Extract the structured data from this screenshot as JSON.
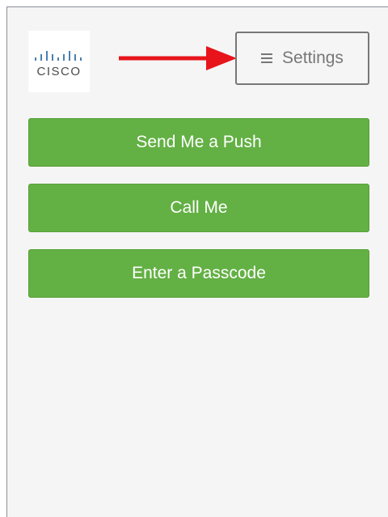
{
  "logo": {
    "text": "CISCO",
    "icon": "cisco-logo"
  },
  "settings": {
    "label": "Settings",
    "icon": "hamburger-menu-icon",
    "color": "#777777"
  },
  "annotation": {
    "icon": "red-arrow-icon",
    "color": "#e8141b"
  },
  "actions": [
    {
      "label": "Send Me a Push"
    },
    {
      "label": "Call Me"
    },
    {
      "label": "Enter a Passcode"
    }
  ],
  "colors": {
    "button_green": "#63b044",
    "background": "#f5f5f5"
  }
}
